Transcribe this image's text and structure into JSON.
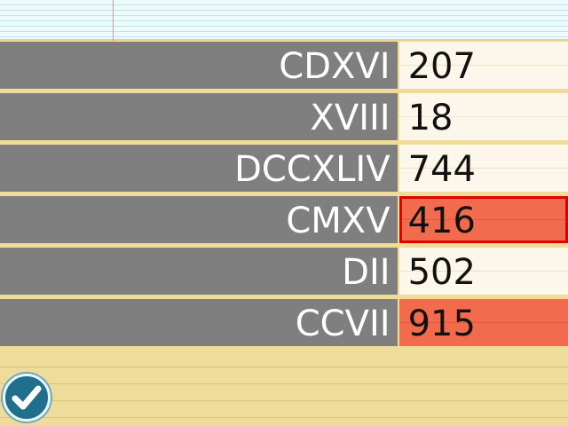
{
  "rows": [
    {
      "roman": "CDXVI",
      "answer": "207",
      "status": "normal"
    },
    {
      "roman": "XVIII",
      "answer": "18",
      "status": "normal"
    },
    {
      "roman": "DCCXLIV",
      "answer": "744",
      "status": "normal"
    },
    {
      "roman": "CMXV",
      "answer": "416",
      "status": "wrong-selected"
    },
    {
      "roman": "DII",
      "answer": "502",
      "status": "normal"
    },
    {
      "roman": "CCVII",
      "answer": "915",
      "status": "wrong"
    }
  ],
  "colors": {
    "wrong": "#f26b4c",
    "selected_outline": "#e00000",
    "roman_bg": "#7f7f7f",
    "answer_bg": "#fcf7ea"
  },
  "check_button": {
    "icon": "checkmark-icon"
  }
}
